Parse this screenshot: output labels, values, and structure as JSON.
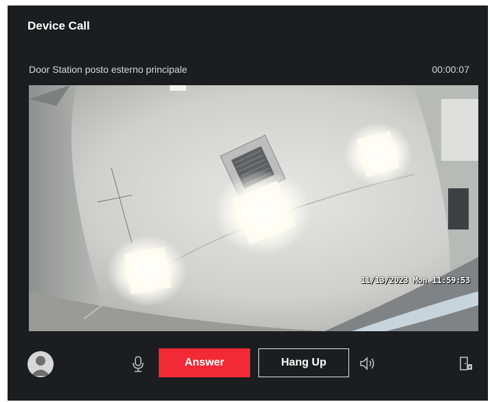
{
  "dialog": {
    "title": "Device Call",
    "device_name": "Door Station posto esterno principale",
    "call_timer": "00:00:07"
  },
  "video": {
    "osd_timestamp": "11/13/2023 Mon 11:59:53"
  },
  "controls": {
    "answer_label": "Answer",
    "hangup_label": "Hang Up",
    "icons": [
      "avatar-icon",
      "microphone-icon",
      "speaker-icon",
      "door-unlock-icon"
    ]
  },
  "colors": {
    "dialog_bg": "#1c1d20",
    "answer_bg": "#f22a35",
    "text": "#ffffff"
  }
}
